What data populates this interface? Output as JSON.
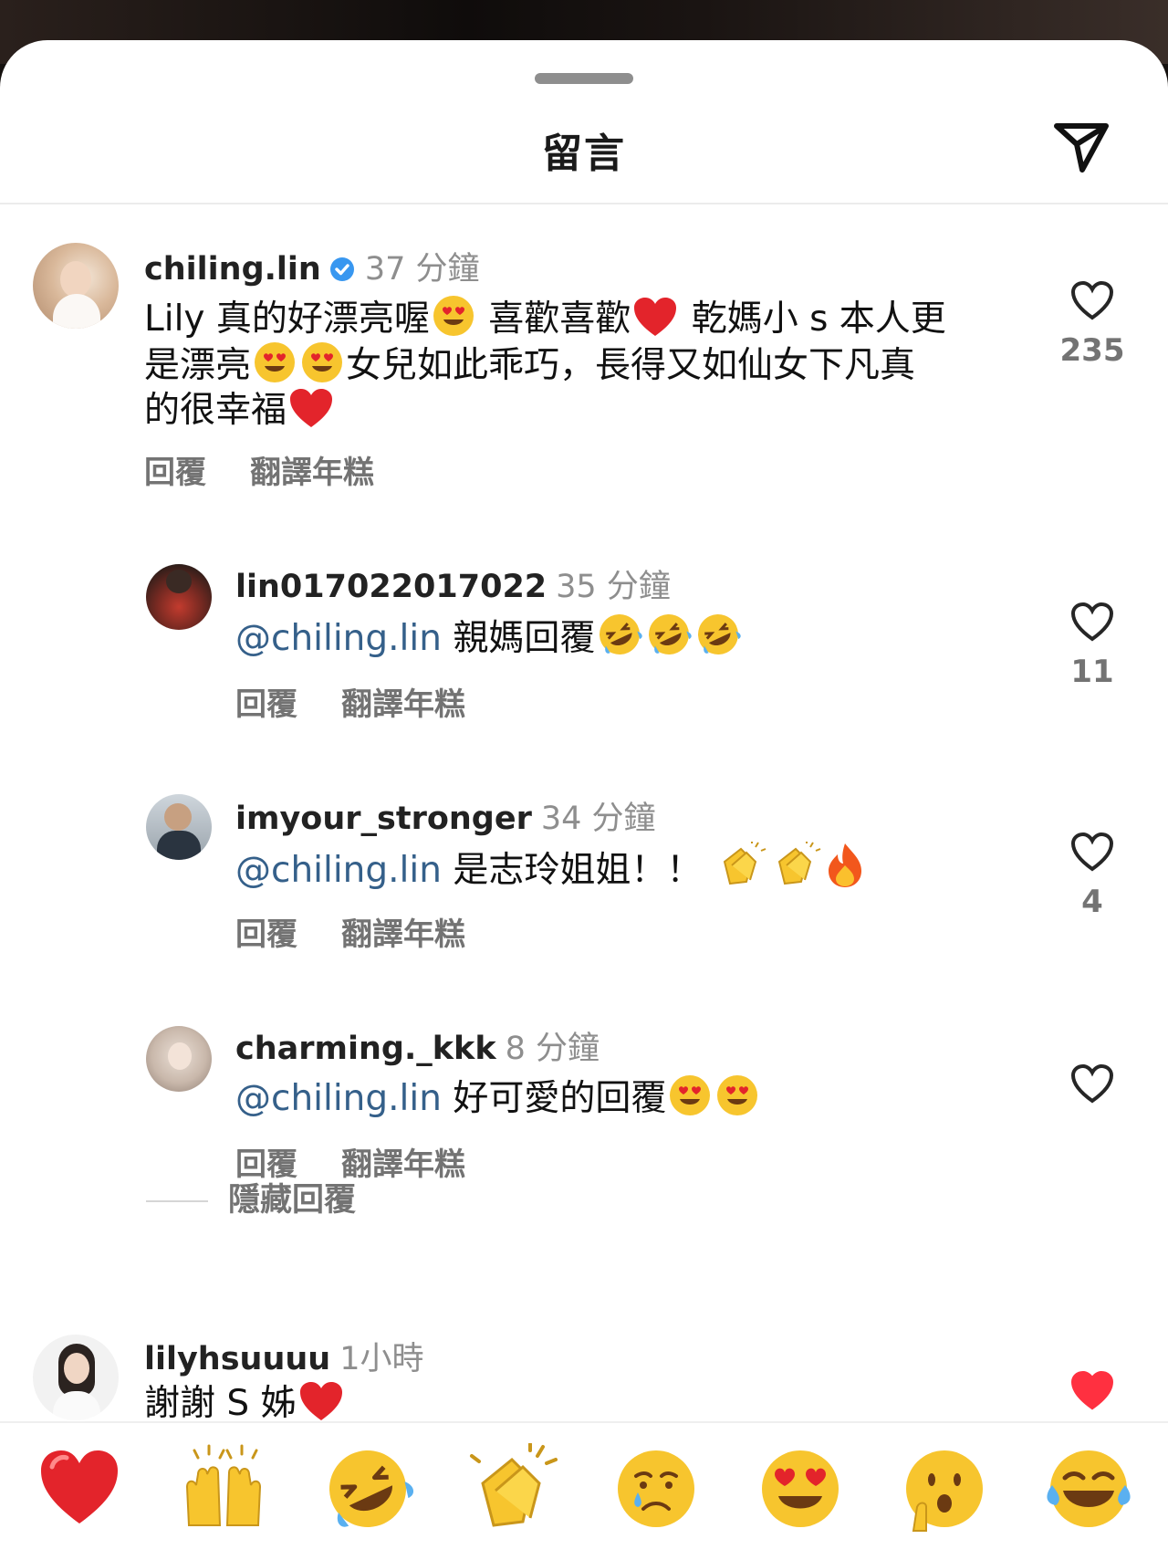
{
  "sheet": {
    "title": "留言"
  },
  "comments": [
    {
      "username": "chiling.lin",
      "verified": true,
      "time": "37 分鐘",
      "lines": [
        "Lily 真的好漂亮喔",
        " 喜歡喜歡",
        " 乾媽小 s 本人更",
        "是漂亮",
        "女兒如此乖巧，長得又如仙女下凡真",
        "的很幸福"
      ],
      "reply_label": "回覆",
      "translate_label": "翻譯年糕",
      "likes": "235"
    },
    {
      "username": "lin017022017022",
      "time": "35 分鐘",
      "mention": "@chiling.lin",
      "text": " 親媽回覆",
      "reply_label": "回覆",
      "translate_label": "翻譯年糕",
      "likes": "11"
    },
    {
      "username": "imyour_stronger",
      "time": "34 分鐘",
      "mention": "@chiling.lin",
      "text": " 是志玲姐姐！！ ",
      "reply_label": "回覆",
      "translate_label": "翻譯年糕",
      "likes": "4"
    },
    {
      "username": "charming._kkk",
      "time": "8 分鐘",
      "mention": "@chiling.lin",
      "text": " 好可愛的回覆",
      "reply_label": "回覆",
      "translate_label": "翻譯年糕"
    },
    {
      "username": "lilyhsuuuu",
      "time": "1小時",
      "text": "謝謝 S 姊"
    }
  ],
  "hide_replies_label": "隱藏回覆",
  "emoji_bar": [
    "red-heart",
    "raising-hands",
    "rolling-laughing",
    "clapping-hands",
    "crying-face",
    "heart-eyes",
    "surprised-face",
    "tears-of-joy"
  ],
  "colors": {
    "mention": "#35608a",
    "like_active": "#ff3040",
    "muted": "#737373"
  }
}
